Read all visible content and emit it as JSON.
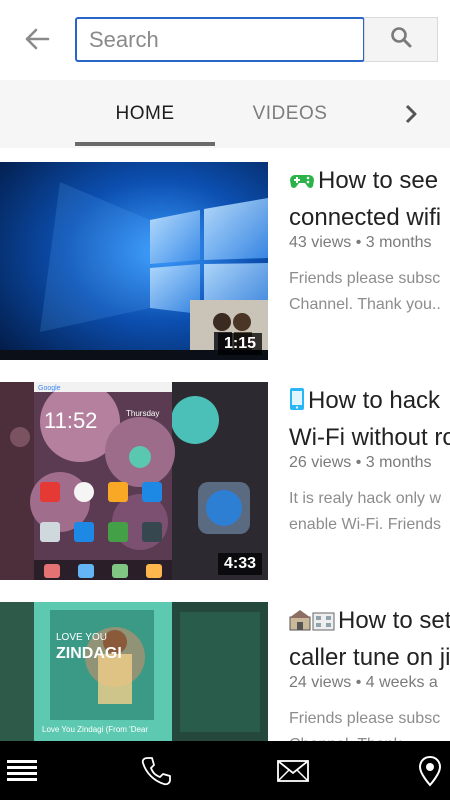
{
  "search": {
    "placeholder": "Search",
    "value": ""
  },
  "tabs": [
    {
      "label": "HOME",
      "selected": true
    },
    {
      "label": "VIDEOS",
      "selected": false
    }
  ],
  "videos": [
    {
      "icon": "gamepad-icon",
      "title_line1": "How to see",
      "title_line2": "connected wifi",
      "meta": "43 views • 3 months",
      "desc_line1": "Friends please subsc",
      "desc_line2": "Channel. Thank you..",
      "duration": "1:15"
    },
    {
      "icon": "phone-icon",
      "title_line1": "How to hack",
      "title_line2": "Wi-Fi without ro",
      "meta": "26 views • 3 months",
      "desc_line1": "It is realy hack only w",
      "desc_line2": "enable Wi-Fi. Friends",
      "duration": "4:33"
    },
    {
      "icon": "hotel-icon",
      "title_line1": "How to set",
      "title_line2": "caller tune on ji",
      "meta": "24 views • 4 weeks a",
      "desc_line1": "Friends please subsc",
      "desc_line2": "Channel. Thank",
      "duration": "",
      "thumb_text": {
        "line1": "LOVE YOU",
        "line2": "ZINDAGI",
        "caption": "Love You Zindagi (From 'Dear"
      }
    }
  ],
  "thumbnail_home_screen": {
    "time": "11:52",
    "day": "Thursday"
  },
  "colors": {
    "accent": "#2a66c7",
    "bottom_bar": "#000000",
    "tab_bg": "#f6f6f6"
  }
}
